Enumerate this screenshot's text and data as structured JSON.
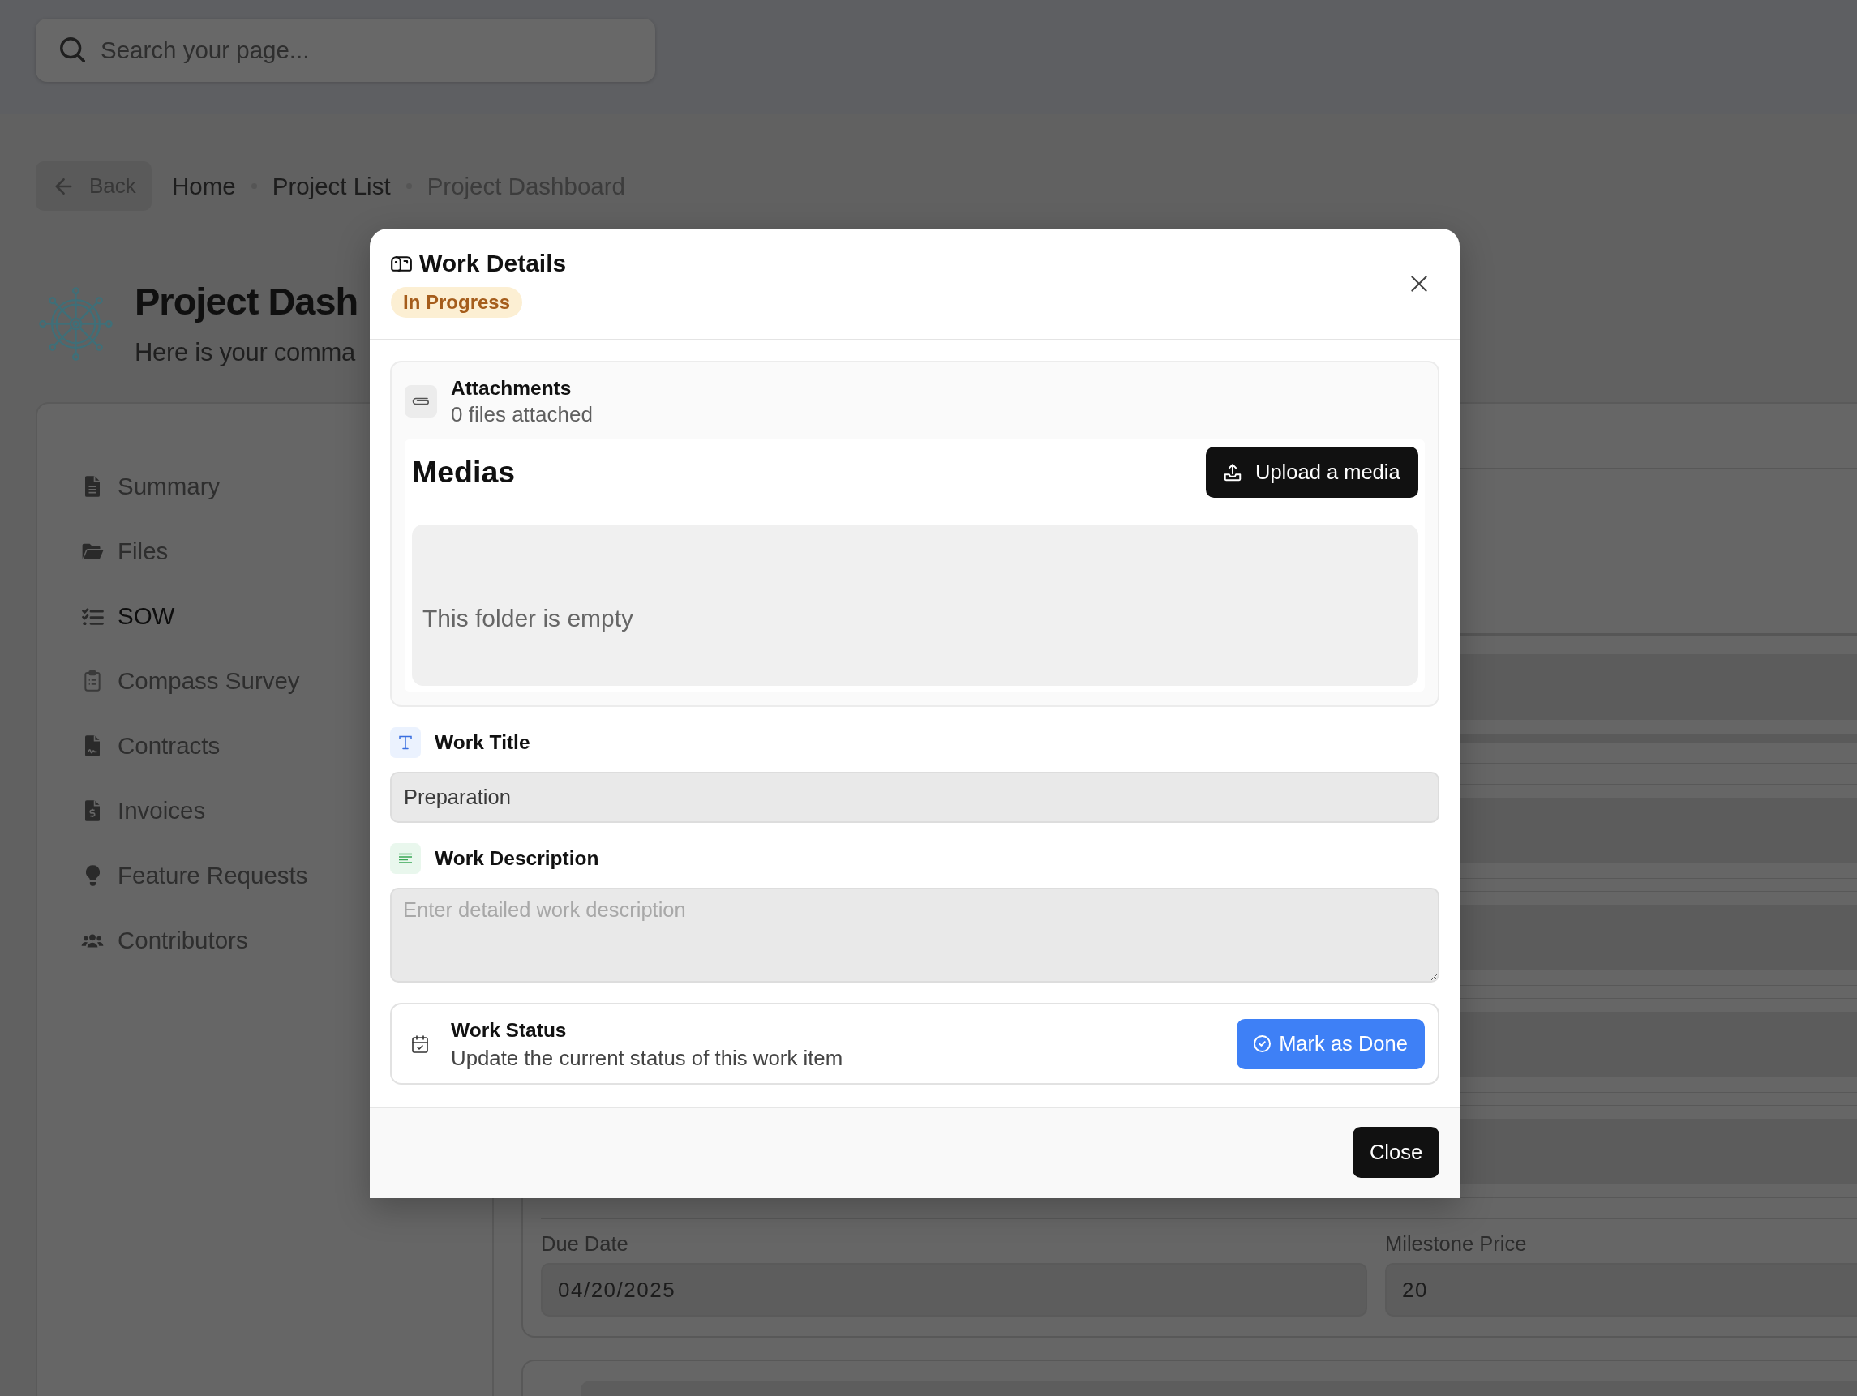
{
  "search": {
    "placeholder": "Search your page..."
  },
  "breadcrumb": {
    "back": "Back",
    "items": [
      {
        "label": "Home",
        "current": false
      },
      {
        "label": "Project List",
        "current": false
      },
      {
        "label": "Project Dashboard",
        "current": true
      }
    ]
  },
  "page_header": {
    "title": "Project Dash",
    "subtitle": "Here is your comma"
  },
  "sidebar": {
    "items": [
      {
        "label": "Summary",
        "selected": false
      },
      {
        "label": "Files",
        "selected": false
      },
      {
        "label": "SOW",
        "selected": true
      },
      {
        "label": "Compass Survey",
        "selected": false
      },
      {
        "label": "Contracts",
        "selected": false
      },
      {
        "label": "Invoices",
        "selected": false
      },
      {
        "label": "Feature Requests",
        "selected": false
      },
      {
        "label": "Contributors",
        "selected": false
      }
    ]
  },
  "milestone": {
    "fields": [
      {
        "label": "Due Date",
        "value": "04/20/2025"
      },
      {
        "label": "Milestone Price",
        "value": "20"
      }
    ]
  },
  "modal": {
    "title": "Work Details",
    "status_badge": "In Progress",
    "attachments": {
      "title": "Attachments",
      "count": "0 files attached",
      "medias_title": "Medias",
      "upload_button": "Upload a media",
      "empty_text": "This folder is empty"
    },
    "work_title": {
      "label": "Work Title",
      "value": "Preparation"
    },
    "work_description": {
      "label": "Work Description",
      "placeholder": "Enter detailed work description"
    },
    "work_status": {
      "title": "Work Status",
      "description": "Update the current status of this work item",
      "button": "Mark as Done"
    },
    "close_button": "Close"
  }
}
